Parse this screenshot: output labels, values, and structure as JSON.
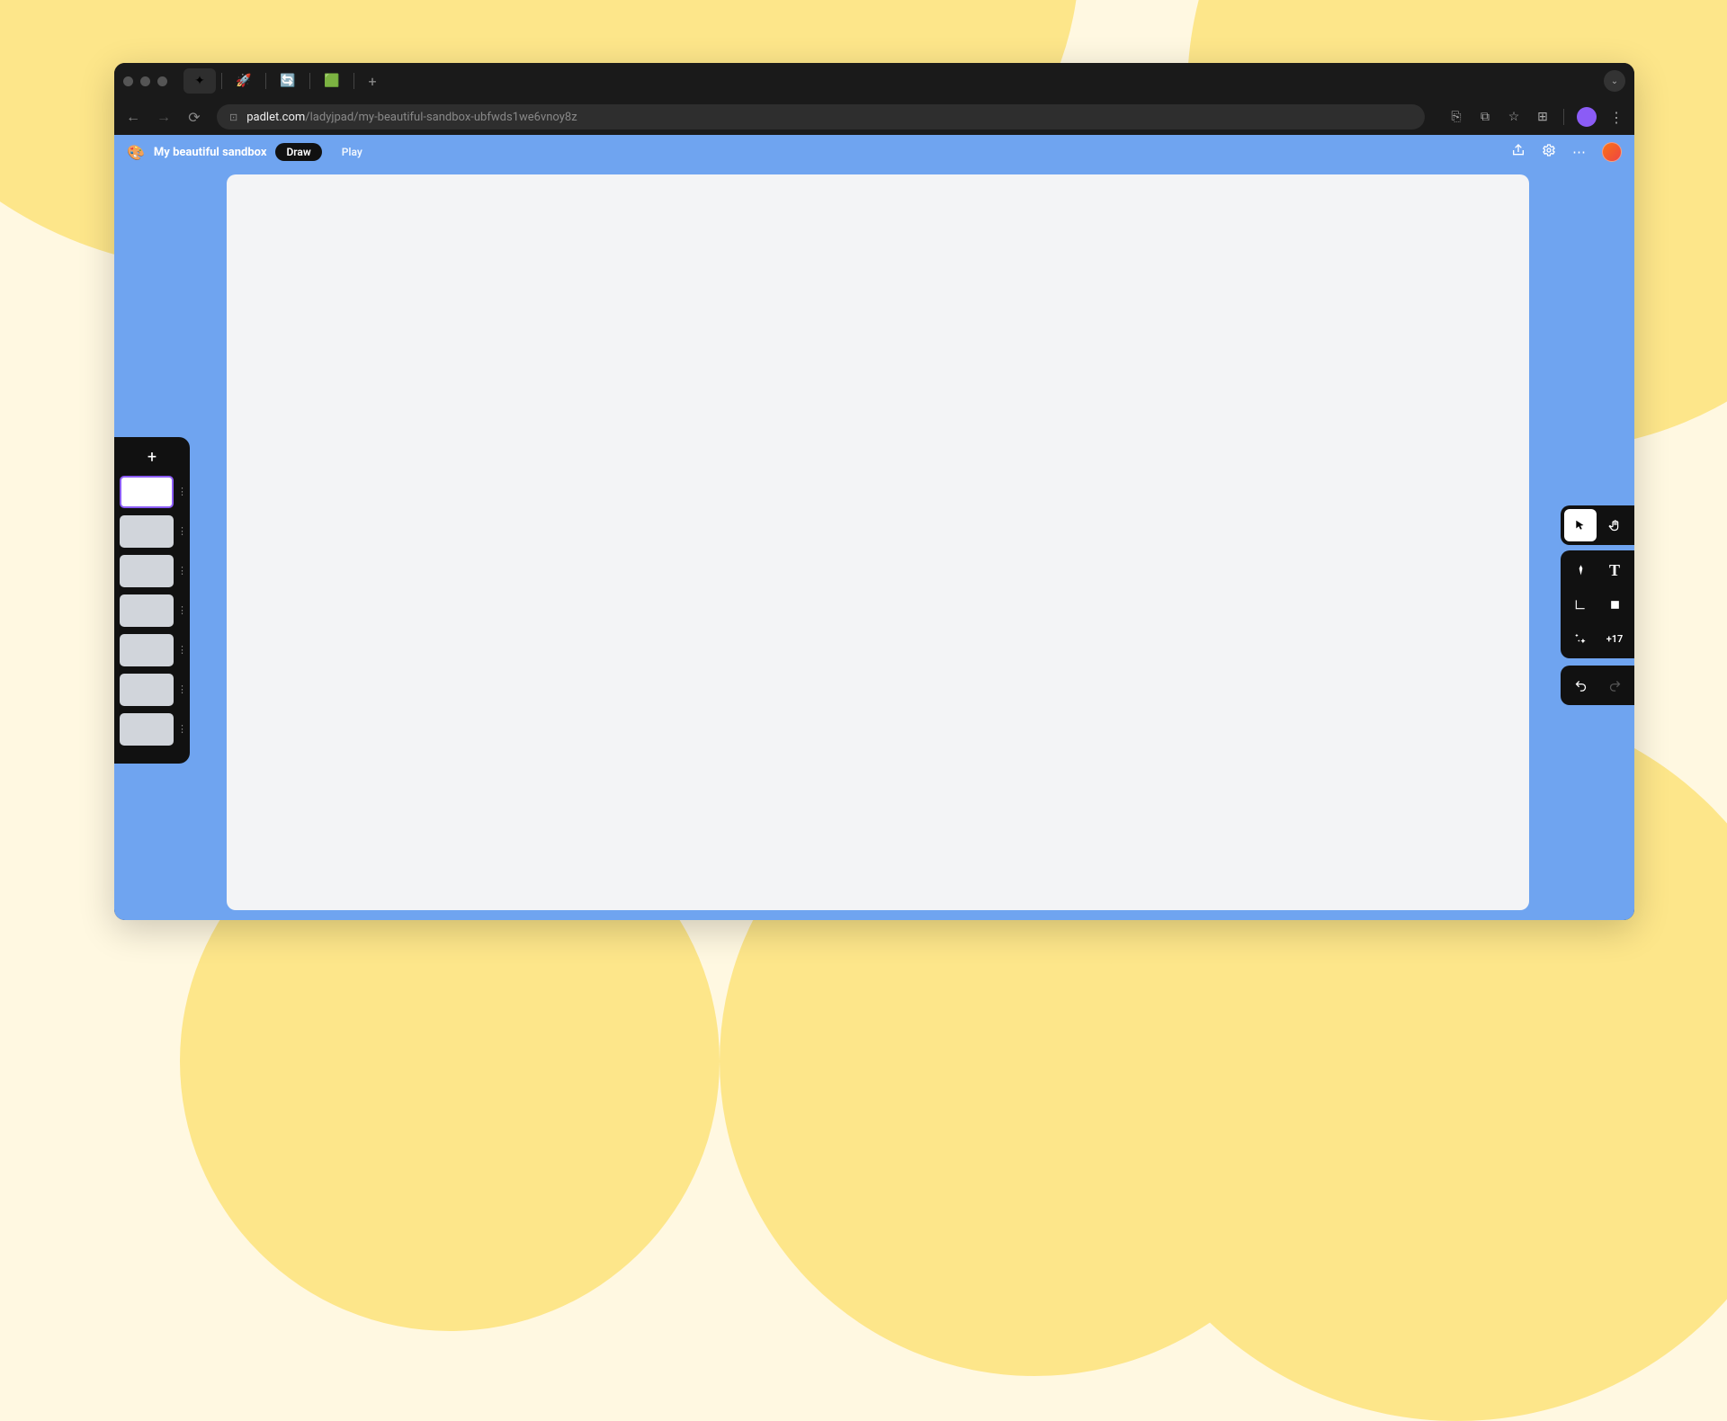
{
  "browser": {
    "url_domain": "padlet.com",
    "url_path": "/ladyjpad/my-beautiful-sandbox-ubfwds1we6vnoy8z",
    "tabs": [
      {
        "icon": "✦",
        "active": true
      },
      {
        "icon": "🚀",
        "active": false
      },
      {
        "icon": "🔄",
        "active": false
      },
      {
        "icon": "🟩",
        "active": false
      }
    ]
  },
  "app": {
    "logo": "🎨",
    "title": "My beautiful sandbox",
    "mode_draw": "Draw",
    "mode_play": "Play"
  },
  "slides": {
    "count": 7,
    "selected": 0
  },
  "tools": {
    "more_count": "+17"
  }
}
